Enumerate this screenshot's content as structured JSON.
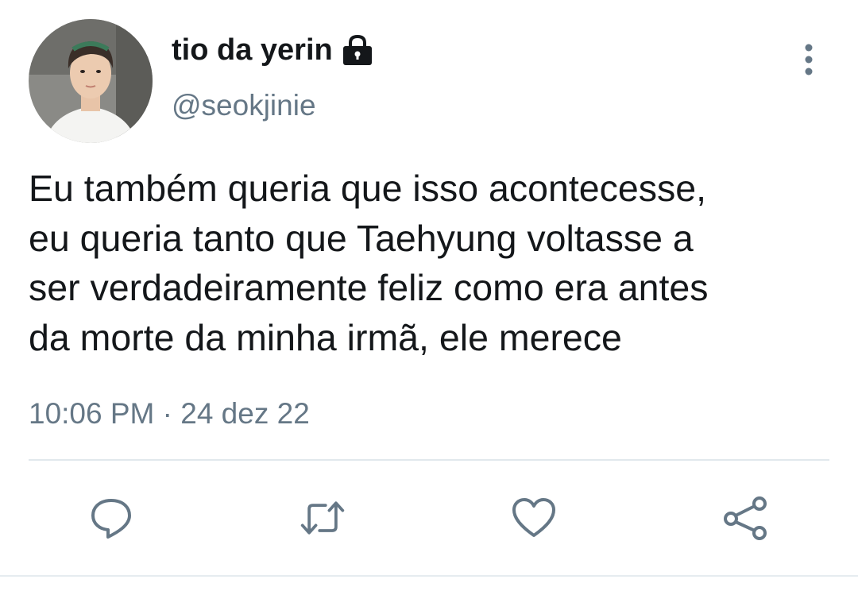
{
  "user": {
    "display_name": "tio da yerin",
    "handle": "@seokjinie",
    "avatar_icon": "profile-photo",
    "protected_icon": "lock-icon"
  },
  "tweet": {
    "lines": [
      "Eu também queria que isso acontecesse,",
      "eu queria tanto que Taehyung voltasse a",
      "ser verdadeiramente feliz como era antes",
      "da morte da minha irmã, ele merece"
    ],
    "timestamp": "10:06 PM · 24 dez 22"
  },
  "actions": {
    "reply_icon": "speech-bubble-icon",
    "retweet_icon": "retweet-icon",
    "like_icon": "heart-icon",
    "share_icon": "share-icon",
    "more_icon": "vertical-dots-icon"
  },
  "colors": {
    "text_primary": "#14171a",
    "text_secondary": "#657786",
    "icon_gray": "#657786",
    "divider": "#e1e8ed",
    "background": "#ffffff"
  }
}
